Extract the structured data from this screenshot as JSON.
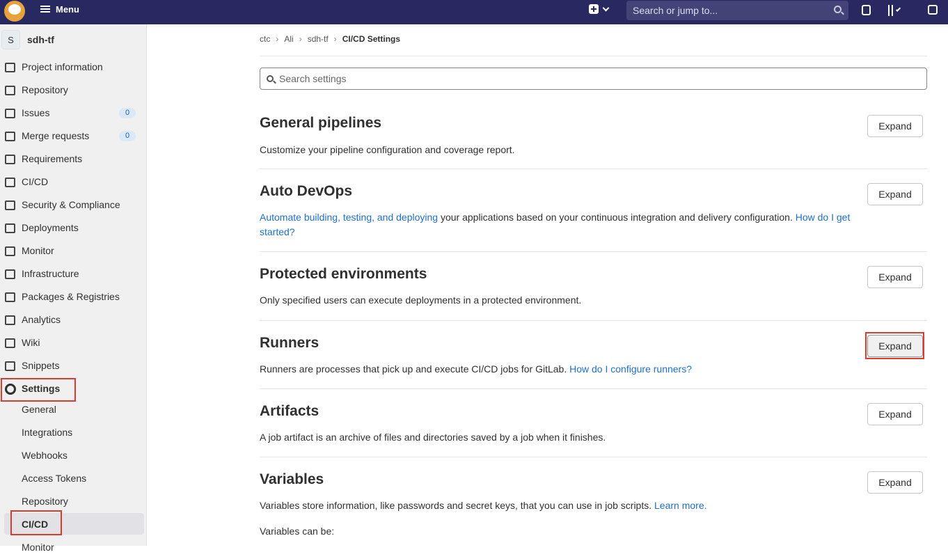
{
  "topbar": {
    "menu_label": "Menu",
    "search_placeholder": "Search or jump to..."
  },
  "project": {
    "avatar_letter": "S",
    "name": "sdh-tf"
  },
  "sidebar": {
    "items": [
      {
        "label": "Project information",
        "icon": "project-icon"
      },
      {
        "label": "Repository",
        "icon": "repository-icon"
      },
      {
        "label": "Issues",
        "icon": "issues-icon",
        "count": "0"
      },
      {
        "label": "Merge requests",
        "icon": "merge-request-icon",
        "count": "0"
      },
      {
        "label": "Requirements",
        "icon": "requirements-icon"
      },
      {
        "label": "CI/CD",
        "icon": "rocket-icon"
      },
      {
        "label": "Security & Compliance",
        "icon": "shield-icon"
      },
      {
        "label": "Deployments",
        "icon": "deployments-icon"
      },
      {
        "label": "Monitor",
        "icon": "monitor-icon"
      },
      {
        "label": "Infrastructure",
        "icon": "cloud-icon"
      },
      {
        "label": "Packages & Registries",
        "icon": "package-icon"
      },
      {
        "label": "Analytics",
        "icon": "chart-icon"
      },
      {
        "label": "Wiki",
        "icon": "book-icon"
      },
      {
        "label": "Snippets",
        "icon": "scissors-icon"
      },
      {
        "label": "Settings",
        "icon": "gear-icon"
      }
    ],
    "settings_sub": [
      {
        "label": "General"
      },
      {
        "label": "Integrations"
      },
      {
        "label": "Webhooks"
      },
      {
        "label": "Access Tokens"
      },
      {
        "label": "Repository"
      },
      {
        "label": "CI/CD"
      },
      {
        "label": "Monitor"
      }
    ]
  },
  "breadcrumb": {
    "items": [
      "ctc",
      "Ali",
      "sdh-tf"
    ],
    "current": "CI/CD Settings"
  },
  "search": {
    "placeholder": "Search settings"
  },
  "sections": {
    "general": {
      "title": "General pipelines",
      "desc": "Customize your pipeline configuration and coverage report.",
      "button": "Expand"
    },
    "autodevops": {
      "title": "Auto DevOps",
      "link1": "Automate building, testing, and deploying",
      "text": " your applications based on your continuous integration and delivery configuration. ",
      "link2": "How do I get started?",
      "button": "Expand"
    },
    "protected": {
      "title": "Protected environments",
      "desc": "Only specified users can execute deployments in a protected environment.",
      "button": "Expand"
    },
    "runners": {
      "title": "Runners",
      "text": "Runners are processes that pick up and execute CI/CD jobs for GitLab. ",
      "link": "How do I configure runners?",
      "button": "Expand"
    },
    "artifacts": {
      "title": "Artifacts",
      "desc": "A job artifact is an archive of files and directories saved by a job when it finishes.",
      "button": "Expand"
    },
    "variables": {
      "title": "Variables",
      "text": "Variables store information, like passwords and secret keys, that you can use in job scripts. ",
      "link": "Learn more.",
      "more": "Variables can be:",
      "button": "Expand"
    }
  },
  "colors": {
    "navbar": "#292961",
    "highlight": "#dd3b2c",
    "link": "#1f6fcc"
  }
}
